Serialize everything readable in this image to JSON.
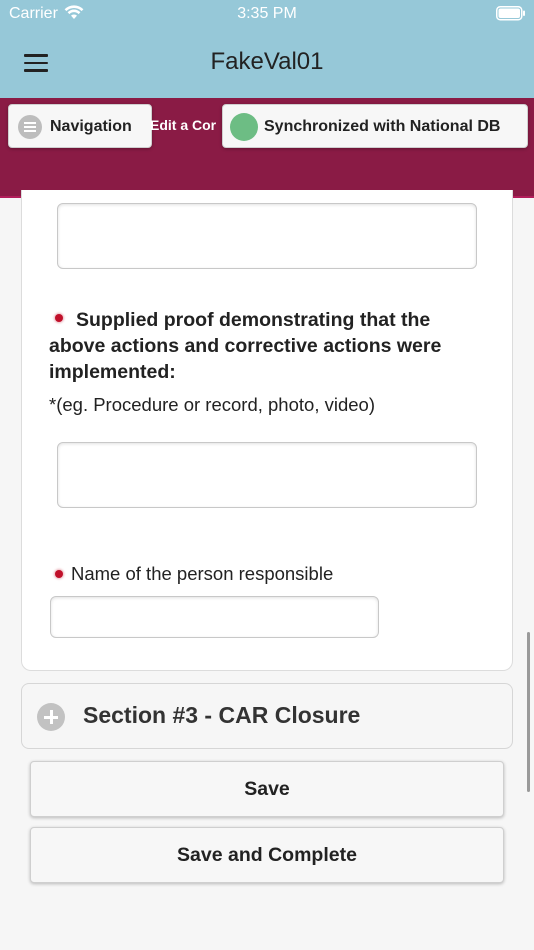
{
  "status_bar": {
    "carrier": "Carrier",
    "time": "3:35 PM"
  },
  "header": {
    "title": "FakeVal01",
    "menu_icon": "hamburger-menu-icon"
  },
  "toolbar": {
    "navigation_label": "Navigation",
    "edit_text": "Edit a Cor",
    "sync_label": "Synchronized with National DB",
    "sync_color": "#6dbd84",
    "toolbar_color": "#8a1b45"
  },
  "form": {
    "proof_question": "Supplied proof demonstrating that the above actions and corrective actions were implemented:",
    "proof_hint": "*(eg. Procedure or record, photo, video)",
    "person_label": "Name of the person responsible",
    "required_color": "#c0102a"
  },
  "section": {
    "label": "Section #3 - CAR Closure",
    "icon": "plus-circle-icon"
  },
  "actions": {
    "save_label": "Save",
    "save_complete_label": "Save and Complete"
  }
}
